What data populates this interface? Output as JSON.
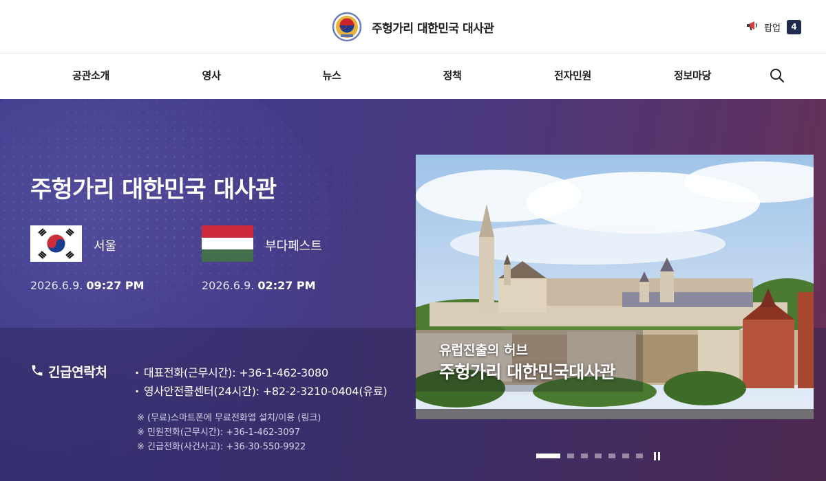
{
  "header": {
    "title": "주헝가리 대한민국 대사관",
    "popup_label": "팝업",
    "popup_count": "4"
  },
  "nav": {
    "items": [
      "공관소개",
      "영사",
      "뉴스",
      "정책",
      "전자민원",
      "정보마당"
    ],
    "search_icon": "search-icon"
  },
  "hero": {
    "title": "주헝가리 대한민국 대사관",
    "clocks": [
      {
        "city": "서울",
        "date": "2026.6.9.",
        "time": "09:27 PM",
        "flag": "korea-flag"
      },
      {
        "city": "부다페스트",
        "date": "2026.6.9.",
        "time": "02:27 PM",
        "flag": "hungary-flag"
      }
    ],
    "contact": {
      "heading": "긴급연락처",
      "icon": "phone-icon",
      "lines": [
        "대표전화(근무시간): +36-1-462-3080",
        "영사안전콜센터(24시간): +82-2-3210-0404(유료)"
      ],
      "notes": [
        "※ (무료)스마트폰에 무료전화앱 설치/이용 (링크)",
        "※ 민원전화(근무시간): +36-1-462-3097",
        "※ 긴급전화(사건사고): +36-30-550-9922"
      ]
    },
    "slide": {
      "subtitle": "유럽진출의 허브",
      "title": "주헝가리 대한민국대사관"
    },
    "pager": {
      "total": 7,
      "active": 1
    }
  },
  "colors": {
    "hero_start": "#3d3b8a",
    "hero_end": "#6a3050",
    "badge": "#1f2c4f"
  }
}
